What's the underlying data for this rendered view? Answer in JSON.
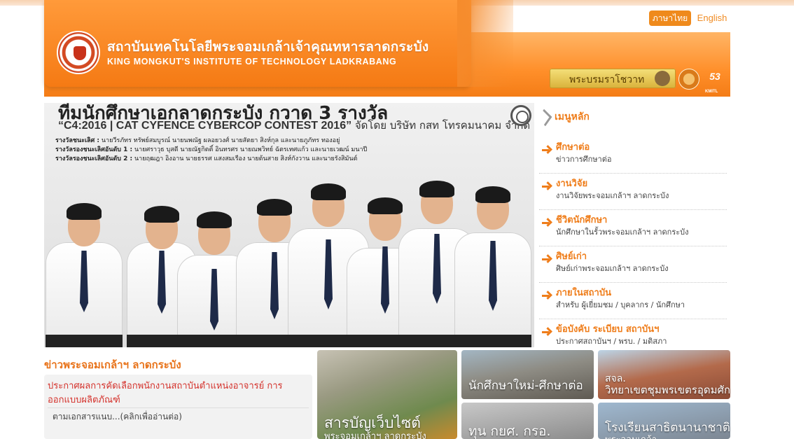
{
  "header": {
    "title_th": "สถาบันเทคโนโลยีพระจอมเกล้าเจ้าคุณทหารลาดกระบัง",
    "title_en": "KING MONGKUT'S INSTITUTE OF TECHNOLOGY LADKRABANG",
    "lang_th": "ภาษาไทย",
    "lang_en": "English",
    "royal_label": "พระบรมราโชวาท",
    "anniversary": "53",
    "anniversary_sub": "KMITL"
  },
  "hero": {
    "headline": "ทีมนักศึกษาเอกลาดกระบัง กวาด 3 รางวัล",
    "contest": "“C4:2016 | CAT CYFENCE CYBERCOP CONTEST 2016”",
    "sponsor": "จัดโดย บริษัท กสท โทรคมนาคม จำกัด (มหาชน)",
    "awards": [
      {
        "label": "รางวัลชนะเลิศ :",
        "names": "นายวีรภัทร ทรัพย์สมบูรณ์ นายนพณัฐ ผลอยวงศ์ นายสัตยา สิงห์กุล และนายภูภัทร ทองอยู่"
      },
      {
        "label": "รางวัลรองชนะเลิศอันดับ 1 :",
        "names": "นายศราวุธ บุสดี นายณัฐกิตติ์ อินทรศร นายณพวิทย์ ฉัตรเทศแก้ว และนายเวฒน์ มนาปี"
      },
      {
        "label": "รางวัลรองชนะเลิศอันดับ 2 :",
        "names": "นายฤฒฎา อิงอาน นายธรรศ แสงสมเรือง นายต้นสาย สิงห์กังวาน และนายรังสิมันต์"
      }
    ]
  },
  "menu": {
    "title": "เมนูหลัก",
    "items": [
      {
        "title": "ศึกษาต่อ",
        "subtitle": "ข่าวการศึกษาต่อ"
      },
      {
        "title": "งานวิจัย",
        "subtitle": "งานวิจัยพระจอมเกล้าฯ ลาดกระบัง"
      },
      {
        "title": "ชีวิตนักศึกษา",
        "subtitle": "นักศึกษาในรั้วพระจอมเกล้าฯ ลาดกระบัง"
      },
      {
        "title": "ศิษย์เก่า",
        "subtitle": "ศิษย์เก่าพระจอมเกล้าฯ ลาดกระบัง"
      },
      {
        "title": "ภายในสถาบัน",
        "subtitle": "สำหรับ ผู้เยี่ยมชม / บุคลากร / นักศึกษา"
      },
      {
        "title": "ข้อบังคับ ระเบียบ สถาบันฯ",
        "subtitle": "ประกาศสถาบันฯ / พรบ. / มติสภา"
      }
    ]
  },
  "news": {
    "section_title": "ข่าวพระจอมเกล้าฯ ลาดกระบัง",
    "headline": "ประกาศผลการคัดเลือกพนักงานสถาบันตำแหน่งอาจารย์ การออกแบบผลิตภัณฑ์",
    "more": "ตามเอกสารแนบ...(คลิกเพื่ออ่านต่อ)"
  },
  "tiles": [
    {
      "caption": "สารบัญเว็บไซต์",
      "caption2": "พระจอมเกล้าฯ ลาดกระบัง"
    },
    {
      "caption": "นักศึกษาใหม่-ศึกษาต่อ"
    },
    {
      "caption": "สจล.",
      "caption2": "วิทยาเขตชุมพรเขตรอุดมศักดิ์"
    },
    {
      "caption": "ทุน กยศ. กรอ."
    },
    {
      "caption": "โรงเรียนสาธิตนานาชาติ",
      "caption2": "พระจอมเกล้า"
    }
  ],
  "colors": {
    "brand_orange": "#f47c16",
    "menu_orange": "#ef7d1a",
    "news_red": "#d4312b"
  }
}
